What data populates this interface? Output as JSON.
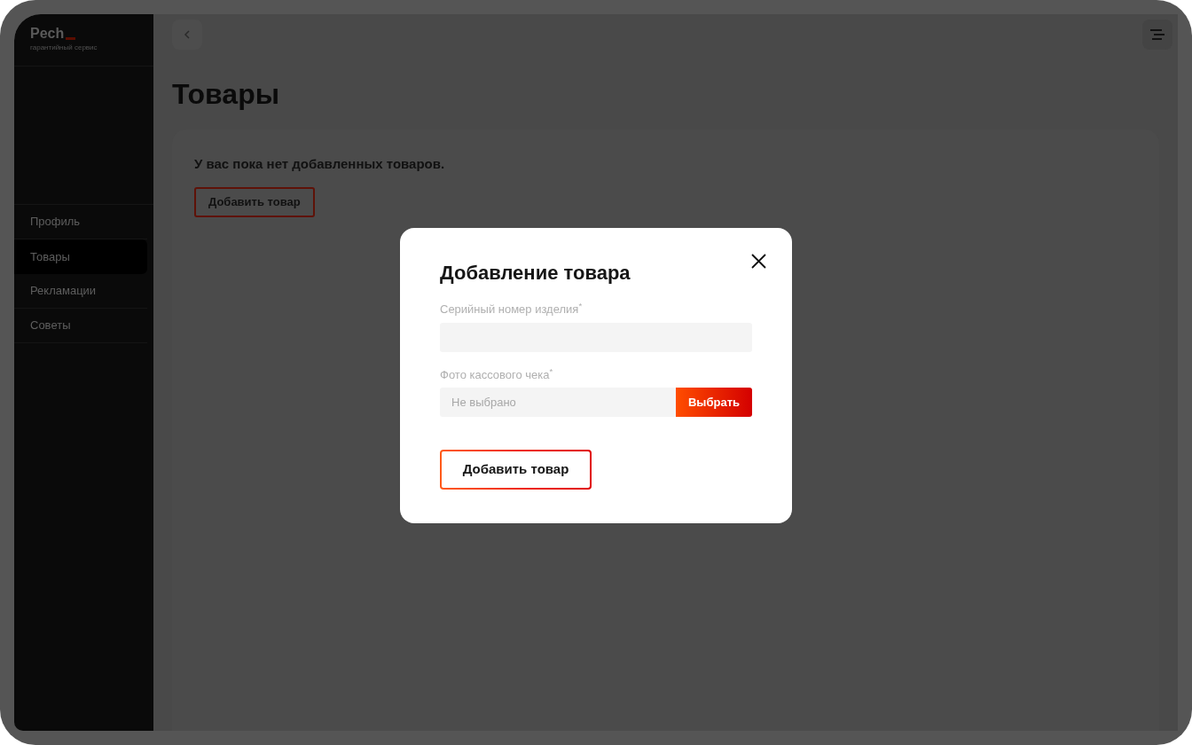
{
  "sidebar": {
    "brand": "Pech",
    "tagline": "гарантийный сервис",
    "items": [
      {
        "label": "Профиль",
        "selected": false
      },
      {
        "label": "Товары",
        "selected": true
      },
      {
        "label": "Рекламации",
        "selected": false
      },
      {
        "label": "Советы",
        "selected": false
      }
    ]
  },
  "page": {
    "title": "Товары",
    "empty_message": "У вас пока нет добавленных товаров.",
    "add_button": "Добавить товар"
  },
  "modal": {
    "title": "Добавление товара",
    "fields": [
      {
        "kind": "text",
        "label": "Серийный номер изделия$^{*}$"
      },
      {
        "kind": "file",
        "label": "Фото кассового чека$^{*}$",
        "status_text": "Не выбрано",
        "button": "Выбрать"
      }
    ],
    "submit": "Добавить товар"
  }
}
